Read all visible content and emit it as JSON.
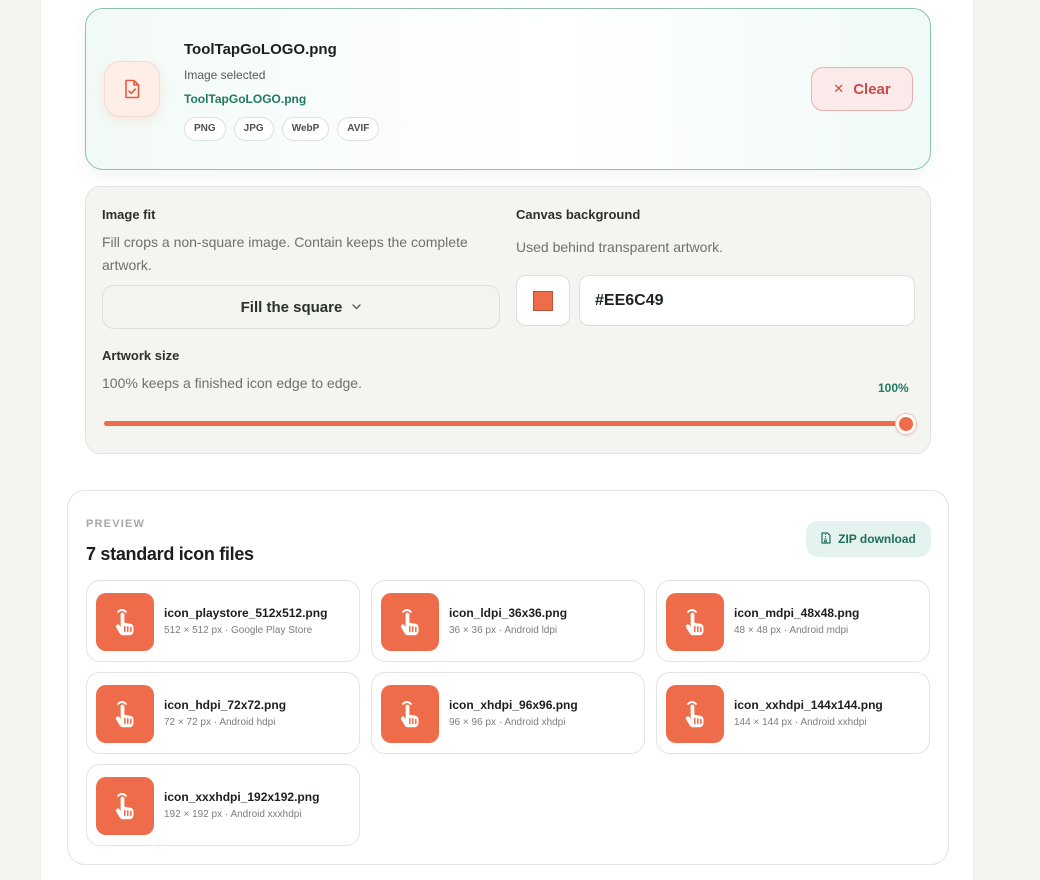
{
  "upload": {
    "file_name": "ToolTapGoLOGO.png",
    "status": "Image selected",
    "file_link": "ToolTapGoLOGO.png",
    "formats": [
      "PNG",
      "JPG",
      "WebP",
      "AVIF"
    ],
    "clear_label": "Clear"
  },
  "settings": {
    "fit": {
      "label": "Image fit",
      "hint": "Fill crops a non-square image. Contain keeps the complete artwork.",
      "selected": "Fill the square"
    },
    "background": {
      "label": "Canvas background",
      "hint": "Used behind transparent artwork.",
      "color": "#EE6C49",
      "value": "#EE6C49"
    },
    "artwork_size": {
      "label": "Artwork size",
      "hint": "100% keeps a finished icon edge to edge.",
      "value_label": "100%",
      "value_fraction": 1.0
    }
  },
  "preview": {
    "eyebrow": "PREVIEW",
    "title": "7 standard icon files",
    "zip_label": "ZIP download",
    "files": [
      {
        "name": "icon_playstore_512x512.png",
        "meta": "512 × 512 px · Google Play Store"
      },
      {
        "name": "icon_ldpi_36x36.png",
        "meta": "36 × 36 px · Android ldpi"
      },
      {
        "name": "icon_mdpi_48x48.png",
        "meta": "48 × 48 px · Android mdpi"
      },
      {
        "name": "icon_hdpi_72x72.png",
        "meta": "72 × 72 px · Android hdpi"
      },
      {
        "name": "icon_xhdpi_96x96.png",
        "meta": "96 × 96 px · Android xhdpi"
      },
      {
        "name": "icon_xxhdpi_144x144.png",
        "meta": "144 × 144 px · Android xxhdpi"
      },
      {
        "name": "icon_xxxhdpi_192x192.png",
        "meta": "192 × 192 px · Android xxxhdpi"
      }
    ]
  },
  "colors": {
    "accent": "#EE6C49",
    "brand_green": "#1F7A5F",
    "danger": "#C94A4A"
  },
  "icons": {
    "file": "file-check-icon",
    "clear": "close-icon",
    "dropdown": "chevron-down-icon",
    "zip": "archive-icon",
    "thumbnail": "tap-hand-icon"
  }
}
